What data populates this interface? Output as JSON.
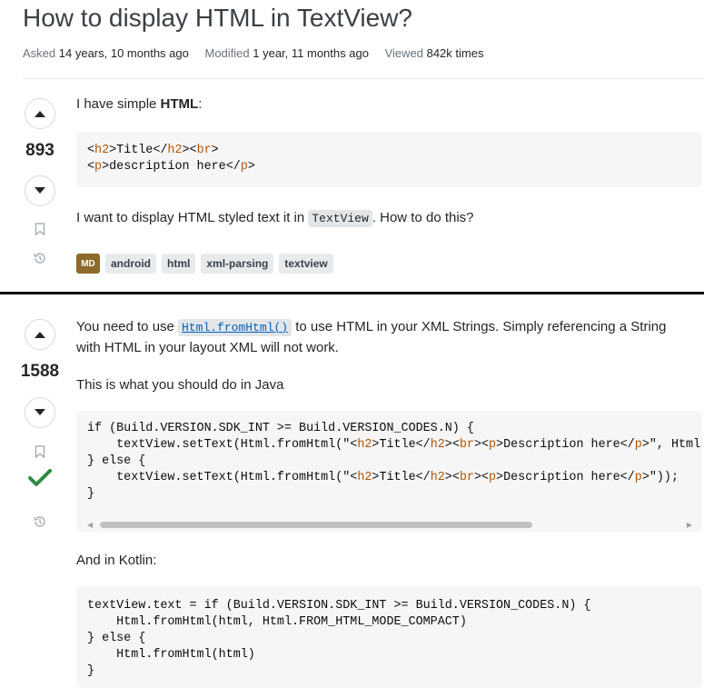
{
  "question": {
    "title": "How to display HTML in TextView?",
    "meta": {
      "asked_label": "Asked",
      "asked_value": "14 years, 10 months ago",
      "modified_label": "Modified",
      "modified_value": "1 year, 11 months ago",
      "viewed_label": "Viewed",
      "viewed_value": "842k times"
    },
    "score": "893",
    "intro_prefix": "I have simple ",
    "intro_bold": "HTML",
    "intro_suffix": ":",
    "code_line1": [
      "<",
      "h2",
      ">Title</",
      "h2",
      "><",
      "br",
      ">"
    ],
    "code_line2": [
      "<",
      "p",
      ">description here</",
      "p",
      ">"
    ],
    "body_prefix": "I want to display HTML styled text it in ",
    "body_code": "TextView",
    "body_suffix": ". How to do this?",
    "badge": "MD",
    "tags": [
      "android",
      "html",
      "xml-parsing",
      "textview"
    ]
  },
  "answer": {
    "score": "1588",
    "accepted": true,
    "para1_prefix": "You need to use ",
    "para1_link": "Html.fromHtml()",
    "para1_suffix": " to use HTML in your XML Strings. Simply referencing a String",
    "para1_line2": "with HTML in your layout XML will not work.",
    "para2": "This is what you should do in Java",
    "java_code": {
      "l1": "if (Build.VERSION.SDK_INT >= Build.VERSION_CODES.N) {",
      "l2a": "    textView.setText(Html.fromHtml(\"",
      "l2b": "\", Html",
      "l3": "} else {",
      "l4a": "    textView.setText(Html.fromHtml(\"",
      "l4b": "\"));",
      "l5": "}",
      "html_parts": [
        "<",
        "h2",
        ">Title</",
        "h2",
        "><",
        "br",
        "><",
        "p",
        ">Description here</",
        "p",
        ">"
      ]
    },
    "para3": "And in Kotlin:",
    "kotlin_code": {
      "l1": "textView.text = if (Build.VERSION.SDK_INT >= Build.VERSION_CODES.N) {",
      "l2": "    Html.fromHtml(html, Html.FROM_HTML_MODE_COMPACT)",
      "l3": "} else {",
      "l4": "    Html.fromHtml(html)",
      "l5": "}"
    }
  }
}
